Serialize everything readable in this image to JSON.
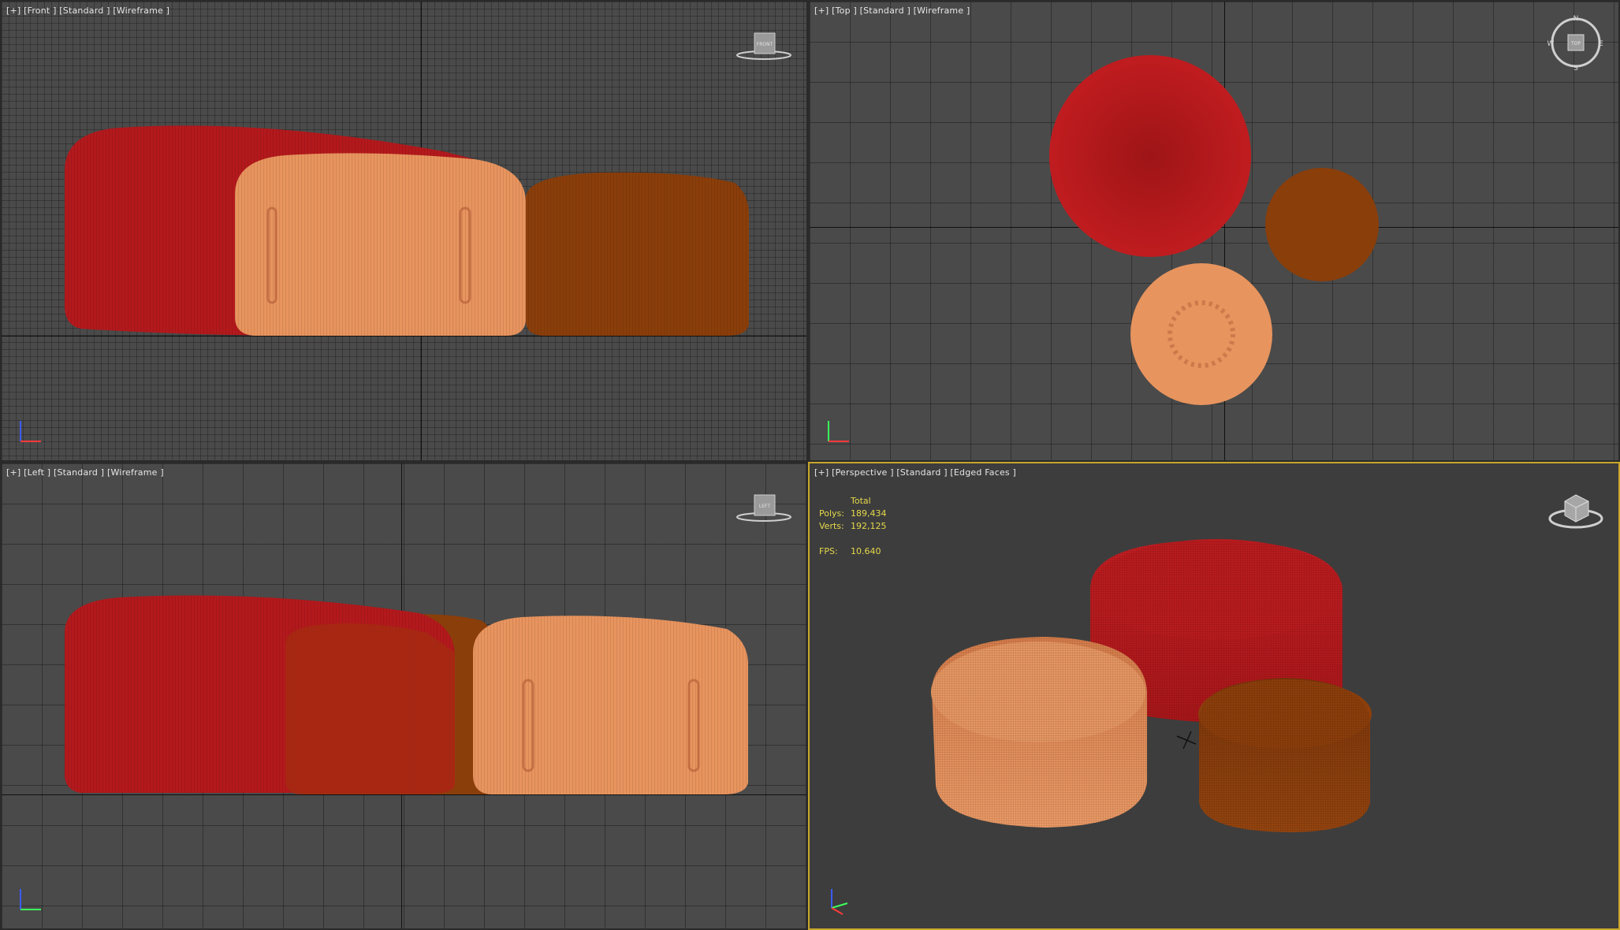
{
  "viewports": {
    "front": {
      "label": "[+] [Front ] [Standard ] [Wireframe ]",
      "viewcube": "FRONT"
    },
    "top": {
      "label": "[+] [Top ] [Standard ] [Wireframe ]",
      "viewcube": "TOP",
      "compass": {
        "n": "N",
        "s": "S",
        "e": "E",
        "w": "W"
      }
    },
    "left": {
      "label": "[+] [Left ] [Standard ] [Wireframe ]",
      "viewcube": "LEFT"
    },
    "perspective": {
      "label": "[+] [Perspective ] [Standard ] [Edged Faces ]",
      "stats": {
        "total_label": "Total",
        "polys_label": "Polys:",
        "polys": "189,434",
        "verts_label": "Verts:",
        "verts": "192,125",
        "fps_label": "FPS:",
        "fps": "10.640"
      }
    }
  },
  "colors": {
    "red": "#b3191c",
    "peach": "#e8945e",
    "brown": "#8a3e0a",
    "active_border": "#c8a82a",
    "stats_text": "#e5d84a"
  }
}
